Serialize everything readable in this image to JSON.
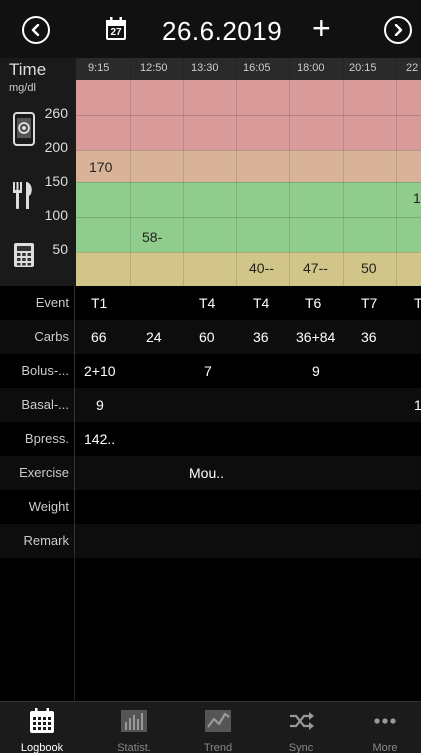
{
  "header": {
    "date": "26.6.2019",
    "calendar_day": "27",
    "plus_label": "+"
  },
  "chart": {
    "time_title": "Time",
    "unit": "mg/dl",
    "y_ticks": [
      "260",
      "200",
      "150",
      "100",
      "50"
    ],
    "times": [
      "9:15",
      "12:50",
      "13:30",
      "16:05",
      "18:00",
      "20:15",
      "22"
    ],
    "glucose_labels": [
      "170",
      "58-",
      "40--",
      "47--",
      "50",
      "1"
    ],
    "band_colors": {
      "high": "#d99a9a",
      "elevated": "#d9b398",
      "target": "#90cc8c",
      "low": "#d2c58a"
    }
  },
  "log": {
    "rows": [
      {
        "label": "Event",
        "cells": [
          "T1",
          "",
          "T4",
          "T4",
          "T6",
          "T7",
          "T"
        ]
      },
      {
        "label": "Carbs",
        "cells": [
          "66",
          "24",
          "60",
          "36",
          "36+84",
          "36",
          ""
        ]
      },
      {
        "label": "Bolus-...",
        "cells": [
          "2+10",
          "",
          "7",
          "",
          "9",
          "",
          ""
        ]
      },
      {
        "label": "Basal-...",
        "cells": [
          "9",
          "",
          "",
          "",
          "",
          "",
          "1"
        ]
      },
      {
        "label": "Bpress.",
        "cells": [
          "142..",
          "",
          "",
          "",
          "",
          "",
          ""
        ]
      },
      {
        "label": "Exercise",
        "cells": [
          "",
          "",
          "Mou..",
          "",
          "",
          "",
          ""
        ]
      },
      {
        "label": "Weight",
        "cells": [
          "",
          "",
          "",
          "",
          "",
          "",
          ""
        ]
      },
      {
        "label": "Remark",
        "cells": [
          "",
          "",
          "",
          "",
          "",
          "",
          ""
        ]
      }
    ]
  },
  "tabs": [
    {
      "label": "Logbook",
      "icon": "calendar-grid-icon",
      "active": true
    },
    {
      "label": "Statist.",
      "icon": "bar-chart-icon",
      "active": false
    },
    {
      "label": "Trend",
      "icon": "trend-line-icon",
      "active": false
    },
    {
      "label": "Sync",
      "icon": "shuffle-icon",
      "active": false
    },
    {
      "label": "More",
      "icon": "more-dots-icon",
      "active": false
    }
  ]
}
